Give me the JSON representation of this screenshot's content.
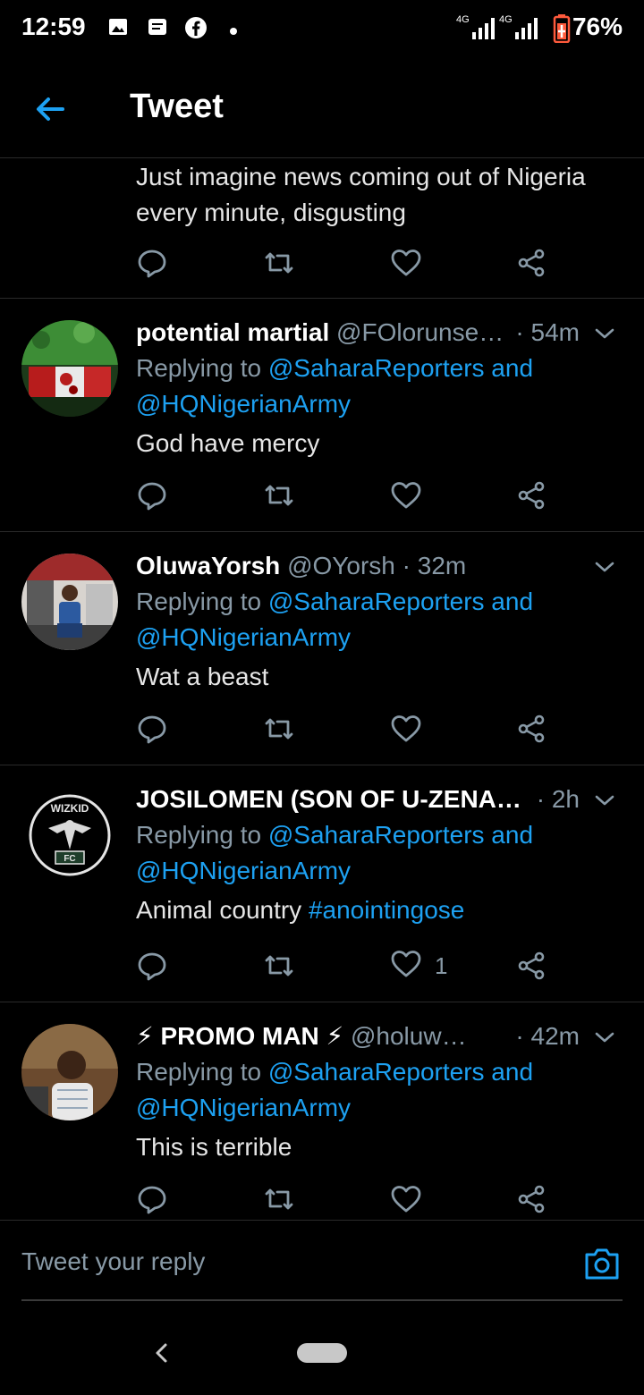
{
  "status_bar": {
    "time": "12:59",
    "battery": "76%",
    "icons": [
      "image-icon",
      "message-icon",
      "facebook-icon",
      "dot-icon",
      "signal-4g-icon",
      "signal-4g-icon",
      "battery-icon"
    ]
  },
  "header": {
    "title": "Tweet"
  },
  "colors": {
    "accent": "#1da1f2",
    "muted": "#8899a6",
    "background": "#000000"
  },
  "tweets": [
    {
      "text": "Just imagine news coming out of Nigeria every minute, disgusting"
    },
    {
      "name": "potential martial",
      "handle": "@FOlorunse…",
      "sep": "·",
      "time": "54m",
      "replying_prefix": "Replying to",
      "replying_to": "@SaharaReporters and @HQNigerianArmy",
      "text": "God have mercy"
    },
    {
      "name": "OluwaYorsh",
      "handle": "@OYorsh",
      "sep": "·",
      "time": "32m",
      "replying_prefix": "Replying to",
      "replying_to": "@SaharaReporters and @HQNigerianArmy",
      "text": "Wat a beast"
    },
    {
      "name": "JOSILOMEN (SON OF U-ZENA…",
      "handle": "",
      "sep": "·",
      "time": "2h",
      "replying_prefix": "Replying to",
      "replying_to": "@SaharaReporters and @HQNigerianArmy",
      "text": "Animal country",
      "hashtag": "#anointingose",
      "like_count": "1",
      "avatar_logo_text": [
        "WIZKID",
        "FC"
      ]
    },
    {
      "name": "⚡ PROMO MAN ⚡",
      "handle": "@holuw…",
      "sep": "·",
      "time": "42m",
      "replying_prefix": "Replying to",
      "replying_to": "@SaharaReporters and @HQNigerianArmy",
      "text": "This is terrible"
    }
  ],
  "composer": {
    "placeholder": "Tweet your reply"
  }
}
